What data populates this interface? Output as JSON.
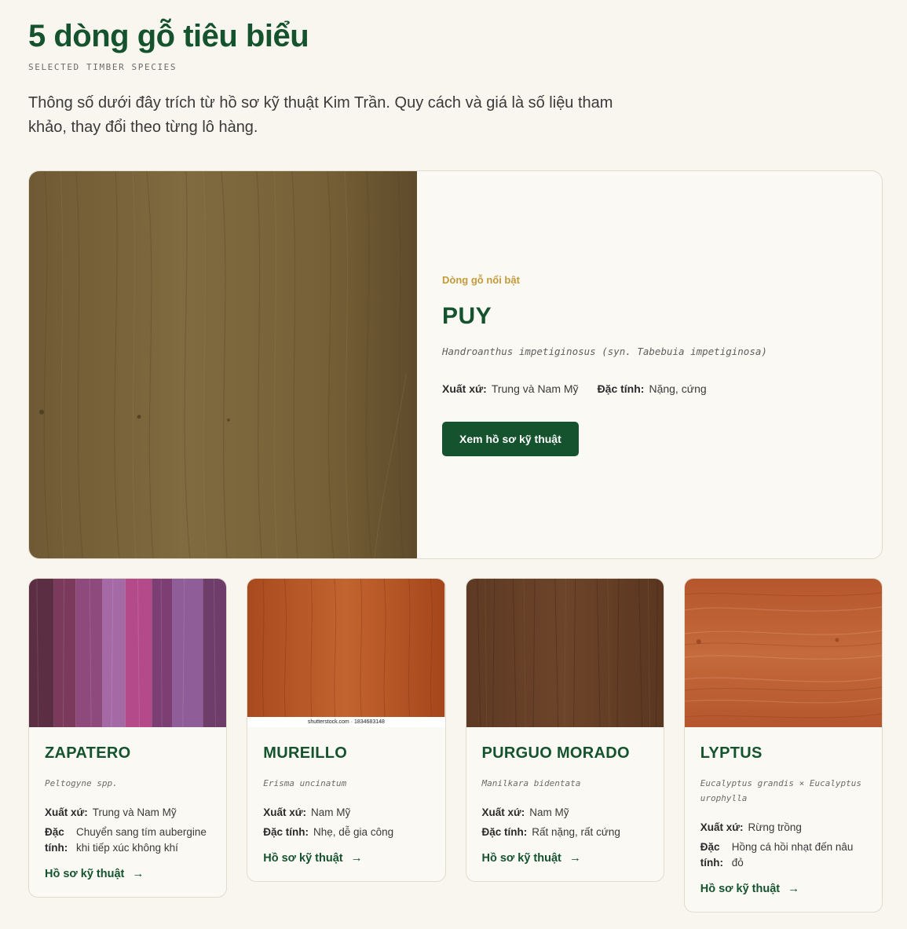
{
  "header": {
    "title": "5 dòng gỗ tiêu biểu",
    "subtitle": "SELECTED TIMBER SPECIES",
    "description": "Thông số dưới đây trích từ hồ sơ kỹ thuật Kim Trần. Quy cách và giá là số liệu tham khảo, thay đổi theo từng lô hàng."
  },
  "featured": {
    "eyebrow": "Dòng gỗ nổi bật",
    "name": "PUY",
    "scientific": "Handroanthus impetiginosus (syn. Tabebuia impetiginosa)",
    "origin_label": "Xuất xứ:",
    "origin": "Trung và Nam Mỹ",
    "property_label": "Đặc tính:",
    "property": "Nặng, cứng",
    "button": "Xem hồ sơ kỹ thuật",
    "image_icon": "wood-texture-olive"
  },
  "cards": [
    {
      "name": "ZAPATERO",
      "scientific": "Peltogyne spp.",
      "origin_label": "Xuất xứ:",
      "origin": "Trung và Nam Mỹ",
      "property_label": "Đặc tính:",
      "property": "Chuyển sang tím aubergine khi tiếp xúc không khí",
      "link": "Hồ sơ kỹ thuật",
      "arrow": "→",
      "image_icon": "wood-texture-purple"
    },
    {
      "name": "MUREILLO",
      "scientific": "Erisma uncinatum",
      "origin_label": "Xuất xứ:",
      "origin": "Nam Mỹ",
      "property_label": "Đặc tính:",
      "property": "Nhẹ, dễ gia công",
      "link": "Hồ sơ kỹ thuật",
      "arrow": "→",
      "image_icon": "wood-texture-orange",
      "watermark": "shutterstock.com · 1834683148"
    },
    {
      "name": "PURGUO MORADO",
      "scientific": "Manilkara bidentata",
      "origin_label": "Xuất xứ:",
      "origin": "Nam Mỹ",
      "property_label": "Đặc tính:",
      "property": "Rất nặng, rất cứng",
      "link": "Hồ sơ kỹ thuật",
      "arrow": "→",
      "image_icon": "wood-texture-brown"
    },
    {
      "name": "LYPTUS",
      "scientific": "Eucalyptus grandis × Eucalyptus urophylla",
      "origin_label": "Xuất xứ:",
      "origin": "Rừng trồng",
      "property_label": "Đặc tính:",
      "property": "Hồng cá hồi nhạt đến nâu đỏ",
      "link": "Hồ sơ kỹ thuật",
      "arrow": "→",
      "image_icon": "wood-texture-salmon"
    }
  ]
}
